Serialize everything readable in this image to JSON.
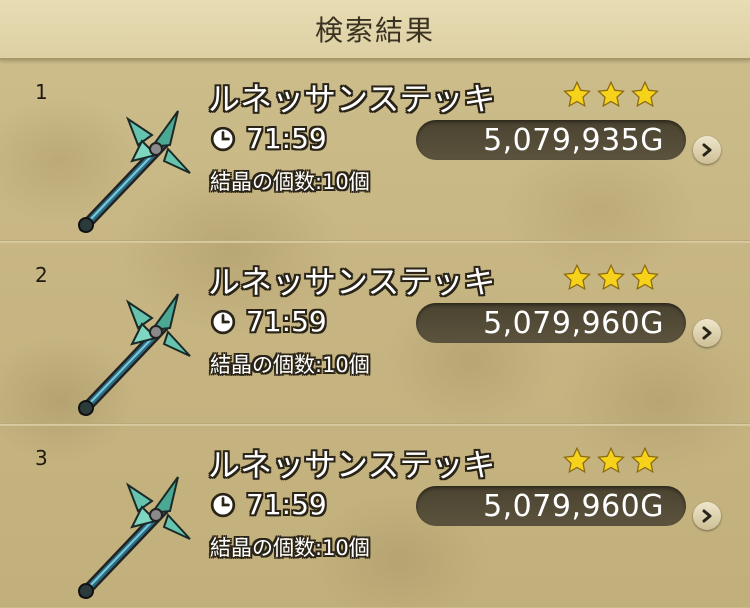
{
  "header": {
    "title": "検索結果"
  },
  "results": [
    {
      "rank": "1",
      "name": "ルネッサンステッキ",
      "time": "71:59",
      "crystals": "結晶の個数:10個",
      "price": "5,079,935G",
      "stars": 3
    },
    {
      "rank": "2",
      "name": "ルネッサンステッキ",
      "time": "71:59",
      "crystals": "結晶の個数:10個",
      "price": "5,079,960G",
      "stars": 3
    },
    {
      "rank": "3",
      "name": "ルネッサンステッキ",
      "time": "71:59",
      "crystals": "結晶の個数:10個",
      "price": "5,079,960G",
      "stars": 3
    }
  ],
  "icons": {
    "item": "staff-icon",
    "clock": "clock-icon",
    "star": "star-icon",
    "next": "chevron-right-icon"
  },
  "colors": {
    "star": "#f6d21a",
    "price_pill": "#4f4833",
    "header_bg": "#e4d8ae"
  }
}
